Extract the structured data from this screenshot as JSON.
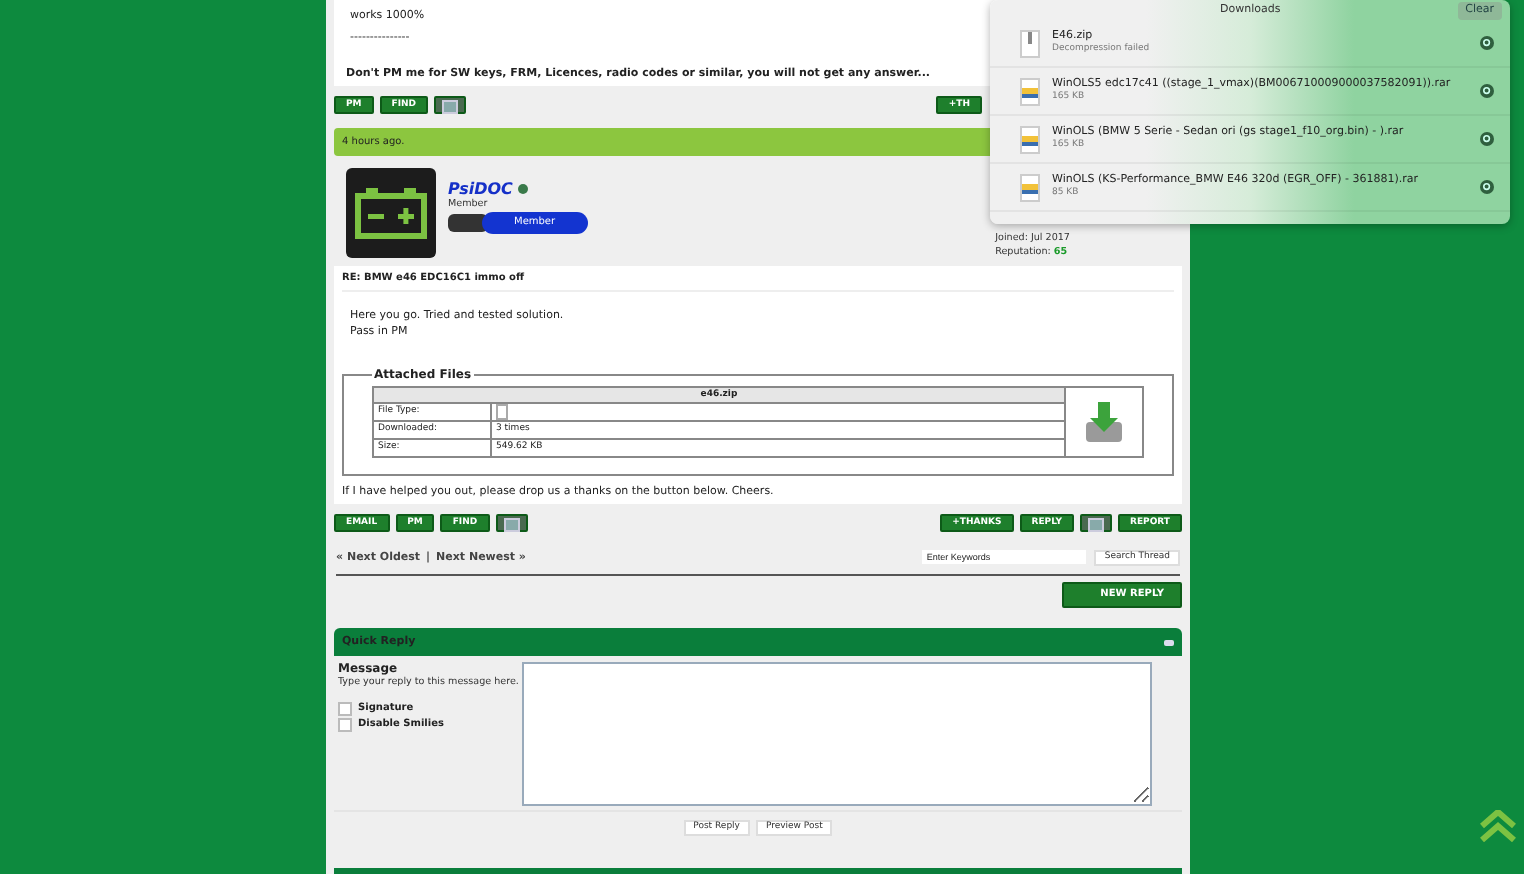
{
  "previous_post": {
    "lines": [
      "works 1000%",
      "---------------"
    ],
    "signature": "Don't PM me for SW keys, FRM, Licences, radio codes or similar, you will not get any answer..."
  },
  "previous_post_buttons": {
    "left": [
      {
        "kind": "pm",
        "label": "PM"
      },
      {
        "kind": "find",
        "label": "FIND"
      },
      {
        "kind": "icon"
      }
    ],
    "right": [
      {
        "kind": "thanks",
        "label": "+TH"
      }
    ]
  },
  "post": {
    "time": "4 hours ago.",
    "author": {
      "name": "PsiDOC",
      "online": true,
      "title": "Member",
      "badge": "Member",
      "joined": "Joined: Jul 2017",
      "reputation_label": "Reputation:",
      "reputation": "65"
    },
    "subject": "RE: BMW e46 EDC16C1 immo off",
    "body": [
      "Here you go. Tried and tested solution.",
      "Pass in PM"
    ],
    "attachments": {
      "legend": "Attached Files",
      "file_name": "e46.zip",
      "rows": [
        {
          "label": "File Type:",
          "kind": "icon"
        },
        {
          "label": "Downloaded:",
          "kind": "text",
          "value": "3 times"
        },
        {
          "label": "Size:",
          "kind": "text",
          "value": "549.62 KB"
        }
      ]
    },
    "signature": "If I have helped you out, please drop us a thanks on the button below. Cheers."
  },
  "post_buttons": {
    "left": [
      {
        "kind": "email",
        "label": "EMAIL"
      },
      {
        "kind": "pm",
        "label": "PM"
      },
      {
        "kind": "find",
        "label": "FIND"
      },
      {
        "kind": "icon"
      }
    ],
    "right": [
      {
        "kind": "thanks",
        "label": "+THANKS"
      },
      {
        "kind": "reply",
        "label": "REPLY"
      },
      {
        "kind": "icon"
      },
      {
        "kind": "report",
        "label": "REPORT"
      }
    ]
  },
  "thread_nav": {
    "oldest": "« Next Oldest",
    "separator": "|",
    "newest": "Next Newest »",
    "search_placeholder": "Enter Keywords",
    "search_button": "Search Thread"
  },
  "new_reply_button": "NEW REPLY",
  "quick_reply": {
    "title": "Quick Reply",
    "label": "Message",
    "hint": "Type your reply to this message here.",
    "options": [
      {
        "label": "Signature",
        "checked": false
      },
      {
        "label": "Disable Smilies",
        "checked": false
      }
    ],
    "buttons": [
      "Post Reply",
      "Preview Post"
    ]
  },
  "downloads": {
    "title": "Downloads",
    "clear": "Clear",
    "items": [
      {
        "kind": "zip",
        "name": "E46.zip",
        "detail": "Decompression failed"
      },
      {
        "kind": "rar",
        "name": "WinOLS5 edc17c41 ((stage_1_vmax)(BM00671000900003758209​1)).rar",
        "detail": "165 KB"
      },
      {
        "kind": "rar",
        "name": "WinOLS (BMW 5 Serie - Sedan ori (gs stage1_f10_org.bin) - ).rar",
        "detail": "165 KB"
      },
      {
        "kind": "rar",
        "name": "WinOLS (KS-Performance_BMW E46 320d (EGR_OFF) - 361881).rar",
        "detail": "85 KB"
      }
    ]
  }
}
